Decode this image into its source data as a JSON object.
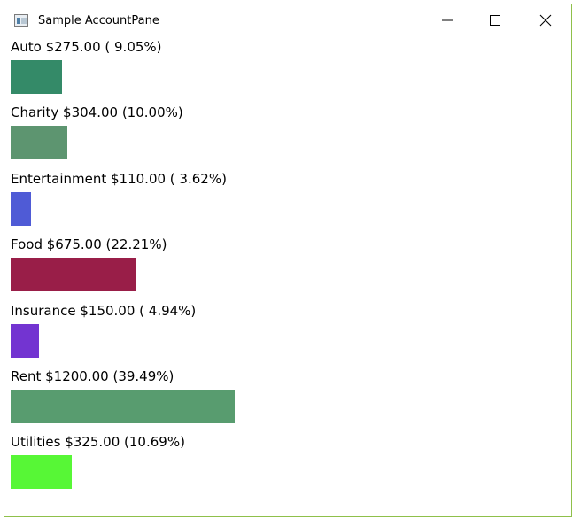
{
  "window": {
    "title": "Sample AccountPane",
    "border_color": "#8fc04a"
  },
  "controls": {
    "minimize": "minimize-icon",
    "maximize": "maximize-icon",
    "close": "close-icon"
  },
  "accounts": [
    {
      "label": "Auto $275.00 ( 9.05%)",
      "name": "Auto",
      "amount": 275.0,
      "percent": 9.05,
      "color": "#348a68"
    },
    {
      "label": "Charity $304.00 (10.00%)",
      "name": "Charity",
      "amount": 304.0,
      "percent": 10.0,
      "color": "#5d9570"
    },
    {
      "label": "Entertainment $110.00 ( 3.62%)",
      "name": "Entertainment",
      "amount": 110.0,
      "percent": 3.62,
      "color": "#4f5bd6"
    },
    {
      "label": "Food $675.00 (22.21%)",
      "name": "Food",
      "amount": 675.0,
      "percent": 22.21,
      "color": "#991e48"
    },
    {
      "label": "Insurance $150.00 ( 4.94%)",
      "name": "Insurance",
      "amount": 150.0,
      "percent": 4.94,
      "color": "#7334d1"
    },
    {
      "label": "Rent $1200.00 (39.49%)",
      "name": "Rent",
      "amount": 1200.0,
      "percent": 39.49,
      "color": "#589c6f"
    },
    {
      "label": "Utilities $325.00 (10.69%)",
      "name": "Utilities",
      "amount": 325.0,
      "percent": 10.69,
      "color": "#57f736"
    }
  ]
}
